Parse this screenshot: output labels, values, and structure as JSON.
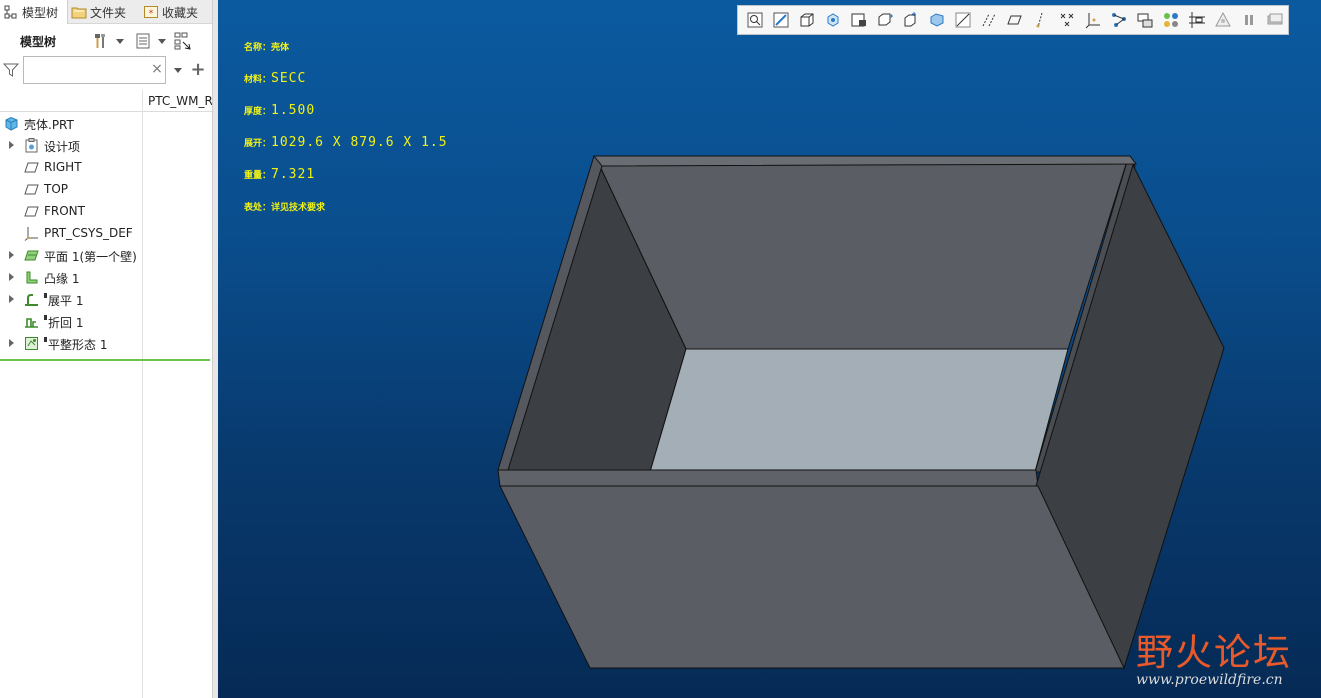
{
  "tabs": [
    {
      "label": "模型树",
      "icon": "model-tree-icon",
      "active": true
    },
    {
      "label": "文件夹",
      "icon": "folder-icon",
      "active": false
    },
    {
      "label": "收藏夹",
      "icon": "favorites-icon",
      "active": false
    }
  ],
  "tree_toolbar": {
    "title": "模型树",
    "settings_icon": "settings-tools-icon",
    "show_icon": "show-list-icon",
    "columns_icon": "tree-columns-icon"
  },
  "filter": {
    "value": "",
    "placeholder": "",
    "clear_icon": "clear-x-icon",
    "add_icon": "add-plus-icon"
  },
  "column_header": "PTC_WM_R",
  "tree": [
    {
      "label": "壳体.PRT",
      "icon": "part-icon",
      "expandable": false,
      "level": 0,
      "modified": false
    },
    {
      "label": "设计项",
      "icon": "design-items-icon",
      "expandable": true,
      "level": 1,
      "modified": false
    },
    {
      "label": "RIGHT",
      "icon": "datum-plane-icon",
      "expandable": false,
      "level": 1,
      "modified": false
    },
    {
      "label": "TOP",
      "icon": "datum-plane-icon",
      "expandable": false,
      "level": 1,
      "modified": false
    },
    {
      "label": "FRONT",
      "icon": "datum-plane-icon",
      "expandable": false,
      "level": 1,
      "modified": false
    },
    {
      "label": "PRT_CSYS_DEF",
      "icon": "csys-icon",
      "expandable": false,
      "level": 1,
      "modified": false
    },
    {
      "label": "平面 1(第一个壁)",
      "icon": "flat-wall-icon",
      "expandable": true,
      "level": 1,
      "modified": false
    },
    {
      "label": "凸缘 1",
      "icon": "flange-icon",
      "expandable": true,
      "level": 1,
      "modified": false
    },
    {
      "label": "展平 1",
      "icon": "unbend-icon",
      "expandable": true,
      "level": 1,
      "modified": true
    },
    {
      "label": "折回 1",
      "icon": "bend-back-icon",
      "expandable": false,
      "level": 1,
      "modified": true
    },
    {
      "label": "平整形态 1",
      "icon": "flat-state-icon",
      "expandable": true,
      "level": 1,
      "modified": true
    }
  ],
  "view_toolbar": [
    "refit-icon",
    "zoom-in-icon",
    "zoom-out-icon",
    "repaint-icon",
    "saved-orientations-icon",
    "named-views-icon",
    "display-style-icon",
    "view-manager-icon",
    "perspective-icon",
    "datum-planes-icon",
    "datum-axes-icon",
    "datum-points-icon",
    "csys-display-icon",
    "annotation-display-icon",
    "spin-center-icon",
    "sketch-view-icon",
    "appearance-icon",
    "section-icon",
    "layers-icon",
    "pause-icon",
    "fullscreen-icon"
  ],
  "annotations": [
    {
      "key": "名称：",
      "value": "壳体",
      "small": true
    },
    {
      "key": "材料：",
      "value": "SECC",
      "small": false
    },
    {
      "key": "厚度：",
      "value": "1.500",
      "small": false
    },
    {
      "key": "展开：",
      "value": "1029.6 X 879.6 X 1.5",
      "small": false
    },
    {
      "key": "重量：",
      "value": "7.321",
      "small": false
    },
    {
      "key": "表处：",
      "value": "详见技术要求",
      "small": true
    }
  ],
  "watermark": {
    "title": "野火论坛",
    "url": "www.proewildfire.cn"
  },
  "colors": {
    "viewport_top": "#0b5aa0",
    "viewport_bottom": "#062a55",
    "annotation": "#f2f214",
    "model_face_dark": "#3c3f44",
    "model_face_mid": "#5a5d63",
    "model_floor": "#a4aeb6",
    "watermark_red": "#e85a2a"
  }
}
